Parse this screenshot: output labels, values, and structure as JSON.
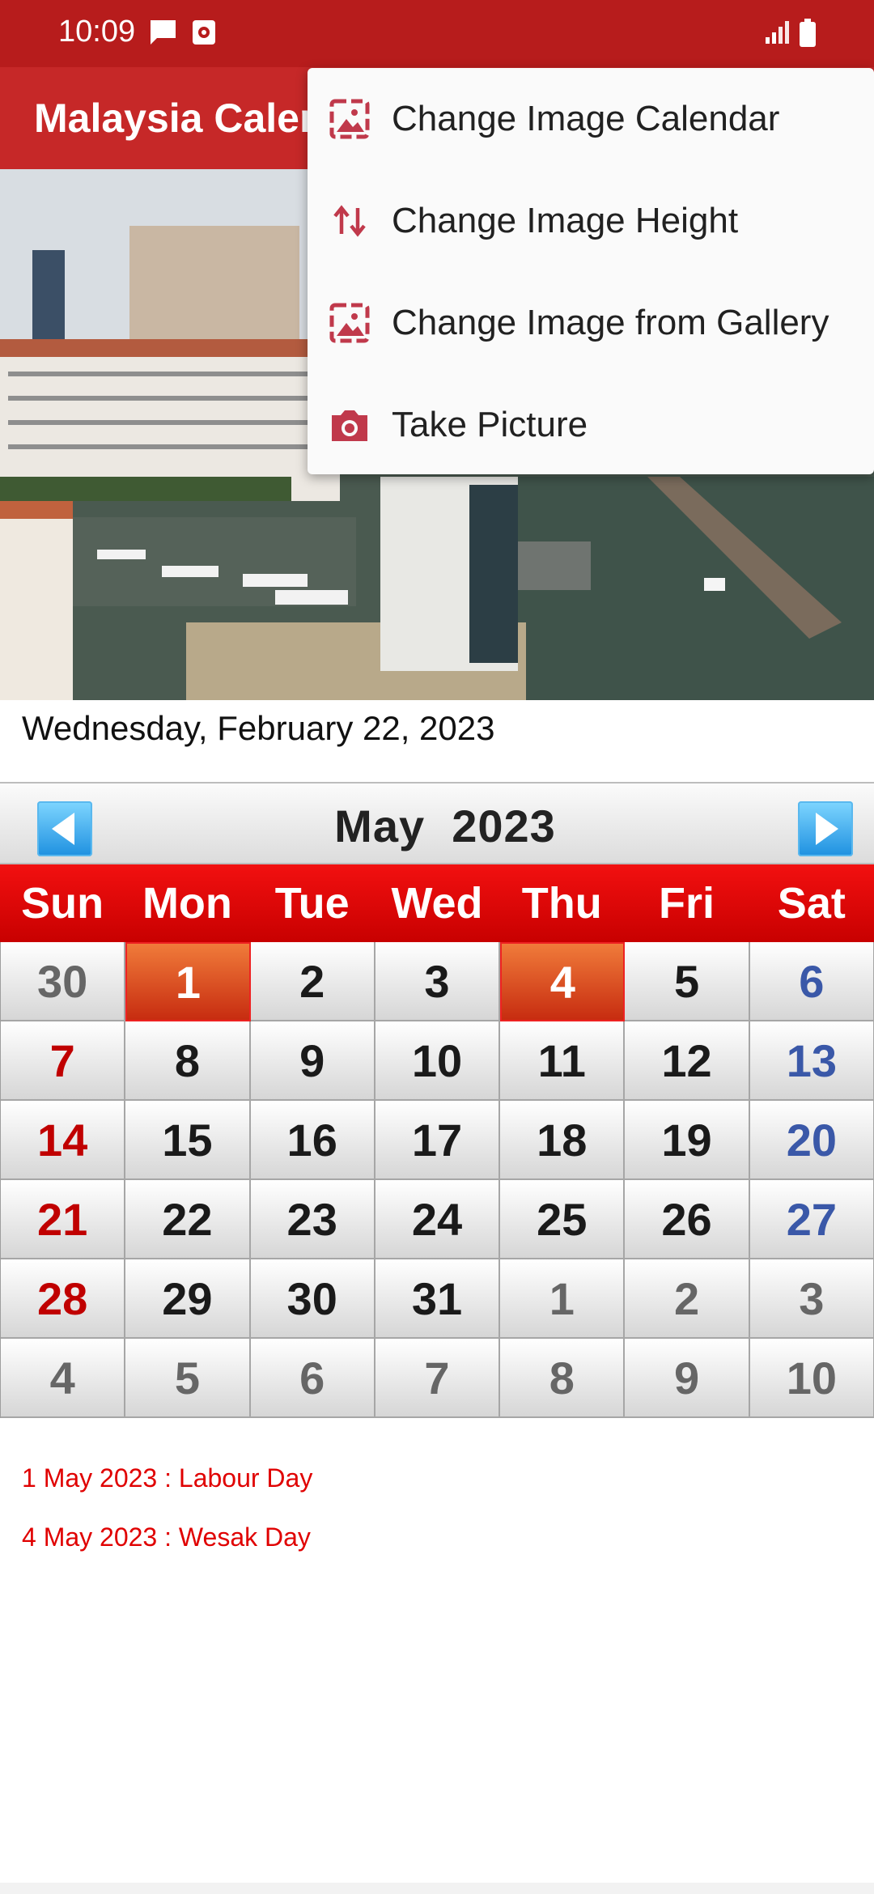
{
  "status_bar": {
    "time": "10:09"
  },
  "app_bar": {
    "title": "Malaysia Calendar"
  },
  "current_date": "Wednesday, February 22, 2023",
  "calendar": {
    "month": "May",
    "year": "2023",
    "weekdays": [
      "Sun",
      "Mon",
      "Tue",
      "Wed",
      "Thu",
      "Fri",
      "Sat"
    ],
    "weeks": [
      [
        "30",
        "1",
        "2",
        "3",
        "4",
        "5",
        "6"
      ],
      [
        "7",
        "8",
        "9",
        "10",
        "11",
        "12",
        "13"
      ],
      [
        "14",
        "15",
        "16",
        "17",
        "18",
        "19",
        "20"
      ],
      [
        "21",
        "22",
        "23",
        "24",
        "25",
        "26",
        "27"
      ],
      [
        "28",
        "29",
        "30",
        "31",
        "1",
        "2",
        "3"
      ],
      [
        "4",
        "5",
        "6",
        "7",
        "8",
        "9",
        "10"
      ]
    ],
    "highlighted": [
      "1",
      "4"
    ]
  },
  "holidays": [
    "1 May 2023 : Labour Day",
    "4 May 2023 : Wesak Day"
  ],
  "menu": {
    "items": [
      {
        "label": "Change Image Calendar",
        "icon": "image-icon"
      },
      {
        "label": "Change Image Height",
        "icon": "swap-vertical-icon"
      },
      {
        "label": "Change Image from Gallery",
        "icon": "image-icon"
      },
      {
        "label": "Take Picture",
        "icon": "camera-icon"
      }
    ]
  },
  "colors": {
    "status_bar": "#b71c1c",
    "app_bar": "#c62828",
    "weekday_header": "#e00000",
    "holiday_cell": "#e2531f",
    "holiday_text": "#e00000",
    "menu_icon": "#c0394b"
  }
}
